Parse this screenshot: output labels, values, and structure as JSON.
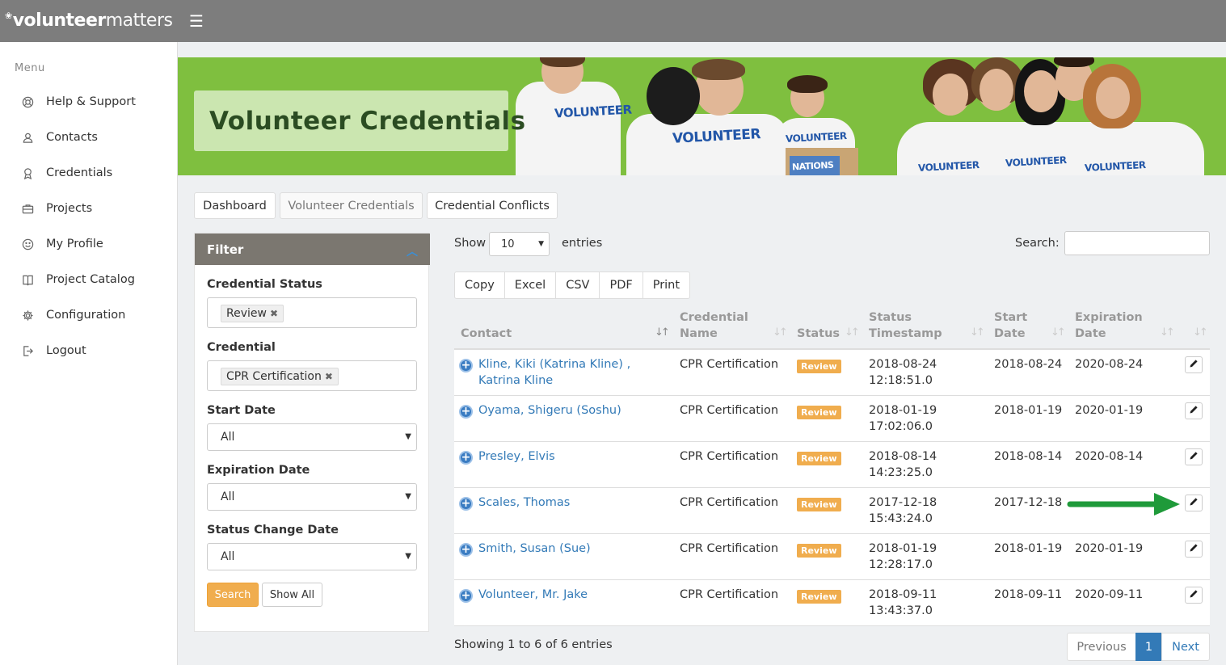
{
  "app": {
    "logo_brand": "volunteer",
    "logo_rest": "matters"
  },
  "sidebar": {
    "menu_title": "Menu",
    "items": [
      {
        "label": "Help & Support",
        "icon": "lifebuoy-icon"
      },
      {
        "label": "Contacts",
        "icon": "contacts-icon"
      },
      {
        "label": "Credentials",
        "icon": "credentials-icon"
      },
      {
        "label": "Projects",
        "icon": "briefcase-icon"
      },
      {
        "label": "My Profile",
        "icon": "smiley-icon"
      },
      {
        "label": "Project Catalog",
        "icon": "book-icon"
      },
      {
        "label": "Configuration",
        "icon": "gear-icon"
      },
      {
        "label": "Logout",
        "icon": "logout-icon"
      }
    ]
  },
  "banner": {
    "title": "Volunteer Credentials",
    "shirt_texts": [
      "VOLUNTEER",
      "VOLUNTEER",
      "VOLUNTEER",
      "NATIONS",
      "VOLUNTEER",
      "VOLUNTEER",
      "VOLUNTEER"
    ]
  },
  "tabs": [
    {
      "label": "Dashboard"
    },
    {
      "label": "Volunteer Credentials",
      "active": true
    },
    {
      "label": "Credential Conflicts"
    }
  ],
  "filter": {
    "title": "Filter",
    "credential_status_label": "Credential Status",
    "credential_status_tag": "Review",
    "credential_label": "Credential",
    "credential_tag": "CPR Certification",
    "start_date_label": "Start Date",
    "start_date_value": "All",
    "expiration_date_label": "Expiration Date",
    "expiration_date_value": "All",
    "status_change_label": "Status Change Date",
    "status_change_value": "All",
    "search_button": "Search",
    "show_all_button": "Show All"
  },
  "table_controls": {
    "show_label": "Show",
    "page_length": "10",
    "entries_label": "entries",
    "search_label": "Search:",
    "search_value": "",
    "export_buttons": [
      "Copy",
      "Excel",
      "CSV",
      "PDF",
      "Print"
    ]
  },
  "table": {
    "headers": {
      "contact": "Contact",
      "credential_name_1": "Credential",
      "credential_name_2": "Name",
      "status": "Status",
      "status_ts_1": "Status",
      "status_ts_2": "Timestamp",
      "start_date_1": "Start",
      "start_date_2": "Date",
      "expiration_1": "Expiration",
      "expiration_2": "Date"
    },
    "rows": [
      {
        "contact_1": "Kline, Kiki (Katrina Kline) ,",
        "contact_2": "Katrina Kline",
        "credential": "CPR Certification",
        "status": "Review",
        "ts_date": "2018-08-24",
        "ts_time": "12:18:51.0",
        "start": "2018-08-24",
        "expiration": "2020-08-24"
      },
      {
        "contact_1": "Oyama, Shigeru (Soshu)",
        "contact_2": "",
        "credential": "CPR Certification",
        "status": "Review",
        "ts_date": "2018-01-19",
        "ts_time": "17:02:06.0",
        "start": "2018-01-19",
        "expiration": "2020-01-19"
      },
      {
        "contact_1": "Presley, Elvis",
        "contact_2": "",
        "credential": "CPR Certification",
        "status": "Review",
        "ts_date": "2018-08-14",
        "ts_time": "14:23:25.0",
        "start": "2018-08-14",
        "expiration": "2020-08-14"
      },
      {
        "contact_1": "Scales, Thomas",
        "contact_2": "",
        "credential": "CPR Certification",
        "status": "Review",
        "ts_date": "2017-12-18",
        "ts_time": "15:43:24.0",
        "start": "2017-12-18",
        "expiration": ""
      },
      {
        "contact_1": "Smith, Susan (Sue)",
        "contact_2": "",
        "credential": "CPR Certification",
        "status": "Review",
        "ts_date": "2018-01-19",
        "ts_time": "12:28:17.0",
        "start": "2018-01-19",
        "expiration": "2020-01-19"
      },
      {
        "contact_1": "Volunteer, Mr. Jake",
        "contact_2": "",
        "credential": "CPR Certification",
        "status": "Review",
        "ts_date": "2018-09-11",
        "ts_time": "13:43:37.0",
        "start": "2018-09-11",
        "expiration": "2020-09-11"
      }
    ]
  },
  "footer": {
    "info": "Showing 1 to 6 of 6 entries",
    "previous": "Previous",
    "current_page": "1",
    "next": "Next"
  },
  "colors": {
    "topbar": "#7d7d7d",
    "banner_green": "#7fbf3f",
    "review_badge": "#f0ad4e",
    "link_blue": "#337ab7",
    "page_active": "#337ab7",
    "arrow_green": "#1f9a3a"
  }
}
